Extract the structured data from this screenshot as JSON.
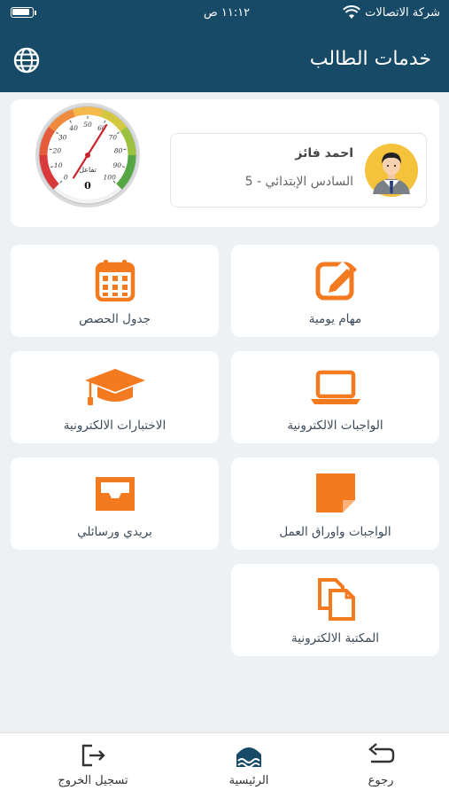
{
  "status_bar": {
    "carrier": "شركة الاتصالات",
    "time": "١١:١٢ ص"
  },
  "header": {
    "title": "خدمات الطالب",
    "globe_icon": "globe-icon"
  },
  "student": {
    "name": "احمد فائز",
    "grade": "السادس الإبتدائي - 5",
    "gauge": {
      "label": "تفاعل",
      "value_text": "0",
      "value": 0,
      "ticks": [
        "0",
        "10",
        "20",
        "30",
        "40",
        "50",
        "60",
        "70",
        "80",
        "90",
        "100"
      ]
    }
  },
  "tiles": [
    {
      "label": "مهام يومية",
      "icon": "edit-note-icon"
    },
    {
      "label": "جدول الحصص",
      "icon": "calendar-icon"
    },
    {
      "label": "الواجبات الالكترونية",
      "icon": "laptop-icon"
    },
    {
      "label": "الاختبارات الالكترونية",
      "icon": "graduation-cap-icon"
    },
    {
      "label": "الواجبات واوراق العمل",
      "icon": "sticky-note-icon"
    },
    {
      "label": "بريدي ورسائلي",
      "icon": "inbox-tray-icon"
    },
    {
      "label": "المكتبة الالكترونية",
      "icon": "documents-icon"
    }
  ],
  "bottom_nav": {
    "back": "رجوع",
    "home": "الرئيسية",
    "logout": "تسجيل الخروج"
  },
  "colors": {
    "header": "#174a67",
    "accent": "#f47a20",
    "background": "#eef1f4"
  }
}
